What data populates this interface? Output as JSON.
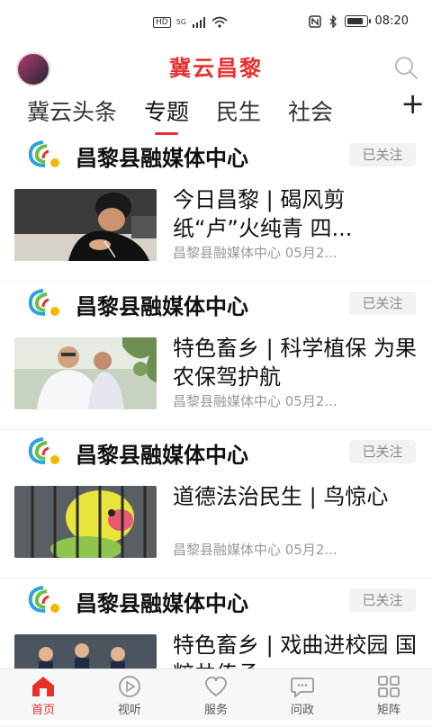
{
  "status_bar": {
    "network": "HD",
    "signal": "5G",
    "time": "08:20"
  },
  "header": {
    "title": "冀云昌黎",
    "search_icon": "search-icon"
  },
  "tabs": [
    {
      "label": "冀云头条"
    },
    {
      "label": "专题"
    },
    {
      "label": "民生"
    },
    {
      "label": "社会"
    }
  ],
  "tabs_more": "+",
  "feed": [
    {
      "source": "昌黎县融媒体中心",
      "follow_label": "已关注",
      "title": "今日昌黎 | 碣风剪纸“卢”火纯青 四...",
      "meta": "昌黎县融媒体中心 05月2..."
    },
    {
      "source": "昌黎县融媒体中心",
      "follow_label": "已关注",
      "title": "特色畜乡 | 科学植保 为果农保驾护航",
      "meta": "昌黎县融媒体中心 05月2..."
    },
    {
      "source": "昌黎县融媒体中心",
      "follow_label": "已关注",
      "title": "道德法治民生 | 鸟惊心",
      "meta": "昌黎县融媒体中心 05月2..."
    },
    {
      "source": "昌黎县融媒体中心",
      "follow_label": "已关注",
      "title": "特色畜乡 | 戏曲进校园 国粹共传承",
      "meta": ""
    }
  ],
  "bottom_nav": [
    {
      "label": "首页",
      "icon": "home-icon",
      "active": true
    },
    {
      "label": "视听",
      "icon": "play-icon",
      "active": false
    },
    {
      "label": "服务",
      "icon": "heart-icon",
      "active": false
    },
    {
      "label": "问政",
      "icon": "chat-icon",
      "active": false
    },
    {
      "label": "矩阵",
      "icon": "grid-icon",
      "active": false
    }
  ],
  "colors": {
    "brand": "#e8302c",
    "text": "#111111",
    "muted": "#999999"
  }
}
